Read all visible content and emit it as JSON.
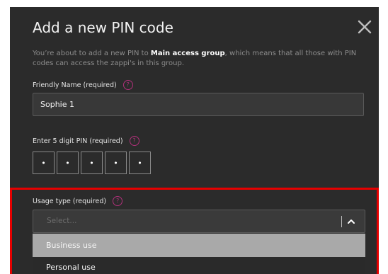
{
  "dialog": {
    "title": "Add a new PIN code",
    "description_pre": "You’re about to add a new PIN to ",
    "description_group": "Main access group",
    "description_post": ", which means that all those with PIN codes can access the zappi's in this group."
  },
  "friendly_name": {
    "label": "Friendly Name (required)",
    "value": "Sophie 1"
  },
  "pin": {
    "label": "Enter 5 digit PIN (required)",
    "digits": [
      "•",
      "•",
      "•",
      "•",
      "•"
    ]
  },
  "usage_type": {
    "label": "Usage type (required)",
    "placeholder": "Select...",
    "options": [
      "Business use",
      "Personal use"
    ]
  },
  "help_glyph": "?",
  "icons": {
    "close": "close-icon",
    "help": "help-circle-icon",
    "dropdown": "chevron-up-icon"
  },
  "colors": {
    "dialog_bg": "#2b2b2b",
    "help_accent": "#b0307a",
    "highlight": "#e60000",
    "option_hover": "#a9a9a9"
  }
}
